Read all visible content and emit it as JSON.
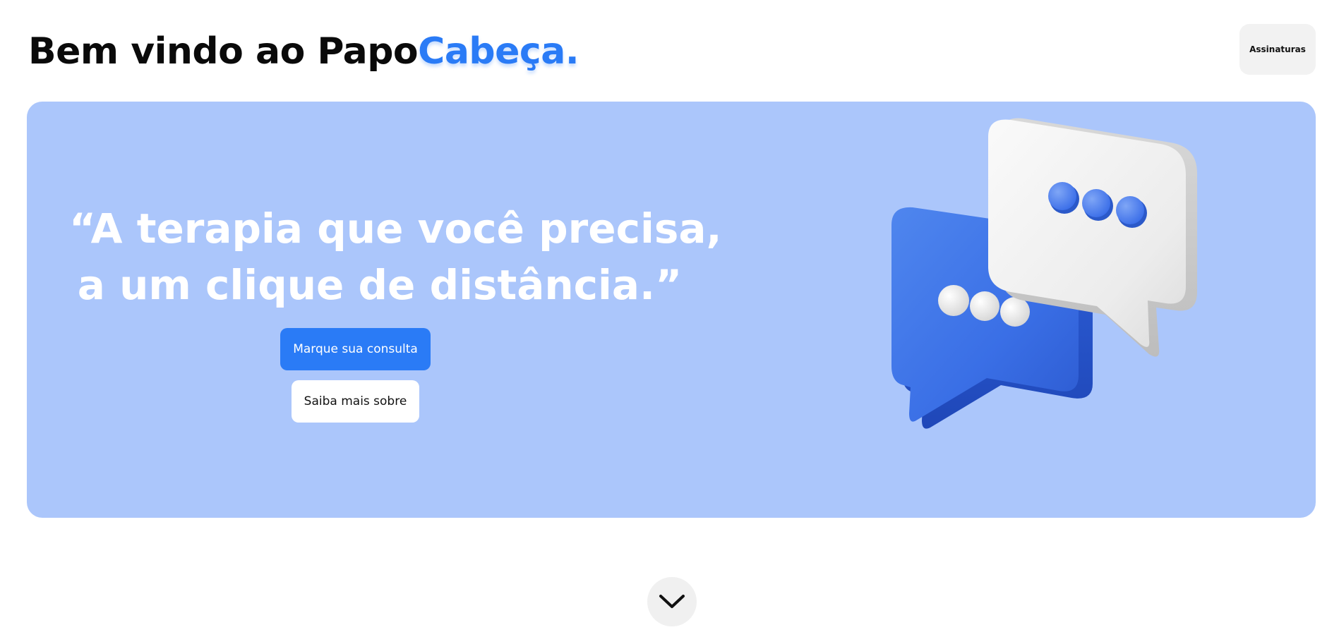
{
  "header": {
    "title_prefix": "Bem vindo ao Papo",
    "title_accent": "Cabeça.",
    "subscriptions_label": "Assinaturas"
  },
  "hero": {
    "quote_line1": "“A terapia que você precisa,",
    "quote_line2": "a um clique de distância.”",
    "primary_cta": "Marque sua consulta",
    "secondary_cta": "Saiba mais sobre",
    "illustration_icon": "chat-bubbles-icon"
  },
  "footer": {
    "scroll_icon": "chevron-down-icon"
  },
  "colors": {
    "accent": "#2a7bf6",
    "hero_background": "#abc6fb",
    "button_light": "#f2f2f2"
  }
}
